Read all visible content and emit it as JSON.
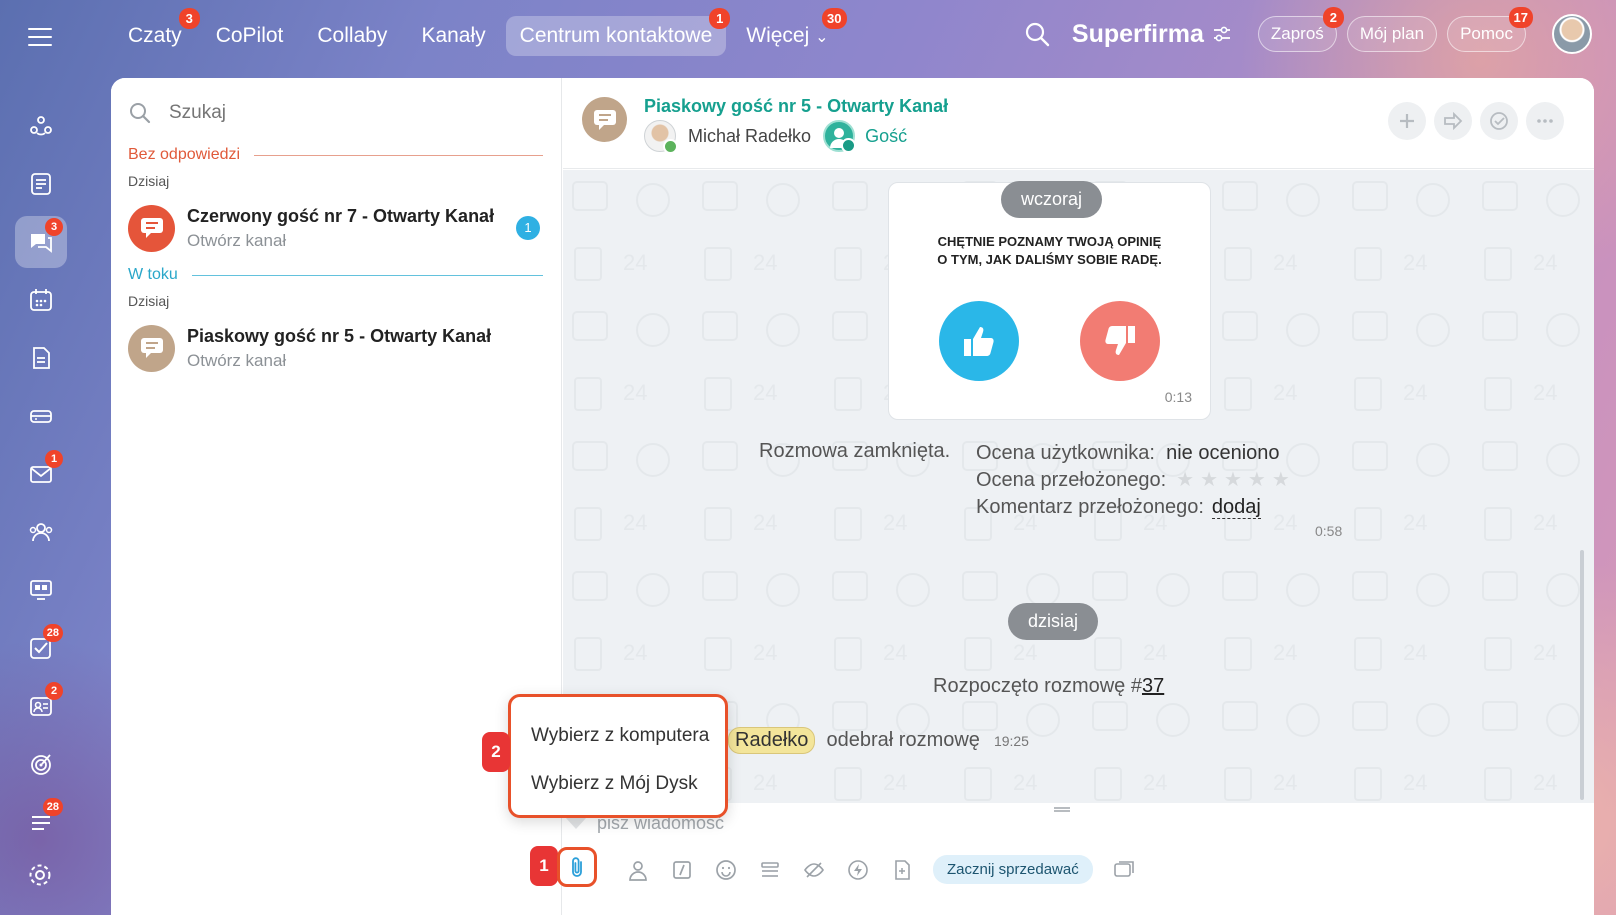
{
  "colors": {
    "accent_teal": "#16a08f",
    "badge_red": "#f0432a",
    "section_unanswered": "#e05a3a",
    "section_inprogress": "#2aa7c9",
    "highlight": "#e8512a"
  },
  "topbar": {
    "tabs": [
      {
        "label": "Czaty",
        "badge": "3"
      },
      {
        "label": "CoPilot",
        "badge": ""
      },
      {
        "label": "Collaby",
        "badge": ""
      },
      {
        "label": "Kanały",
        "badge": ""
      },
      {
        "label": "Centrum kontaktowe",
        "badge": "1",
        "active": true
      },
      {
        "label": "Więcej",
        "badge": "30"
      }
    ],
    "more_chevron": "⌄",
    "company": "Superfirma",
    "invite_label": "Zaproś",
    "invite_badge": "2",
    "plan_label": "Mój plan",
    "help_label": "Pomoc",
    "help_badge": "17"
  },
  "sidebar": {
    "badges": {
      "chats": "3",
      "mail": "1",
      "tasks": "28",
      "crm": "2",
      "feed": "28"
    }
  },
  "list": {
    "search_placeholder": "Szukaj",
    "section_unanswered": "Bez odpowiedzi",
    "section_inprogress": "W toku",
    "day1": "Dzisiaj",
    "day2": "Dzisiaj",
    "items": [
      {
        "title": "Czerwony gość nr 7 - Otwarty Kanał",
        "subtitle": "Otwórz kanał",
        "count": "1"
      },
      {
        "title": "Piaskowy gość nr 5 - Otwarty Kanał",
        "subtitle": "Otwórz kanał"
      }
    ]
  },
  "chat": {
    "title": "Piaskowy gość nr 5 - Otwarty Kanał",
    "member1": "Michał Radełko",
    "member2": "Gość",
    "date_yesterday": "wczoraj",
    "survey_line1": "CHĘTNIE POZNAMY TWOJĄ OPINIĘ",
    "survey_line2": "O TYM, JAK DALIŚMY SOBIE RADĘ.",
    "survey_time": "0:13",
    "closed": "Rozmowa zamknięta.",
    "user_rating_label": "Ocena użytkownika:",
    "user_rating_value": "nie oceniono",
    "supervisor_rating_label": "Ocena przełożonego:",
    "supervisor_comment_label": "Komentarz przełożonego:",
    "add_link": "dodaj",
    "closed_time": "0:58",
    "date_today": "dzisiaj",
    "started_prefix": "Rozpoczęto rozmowę #",
    "started_number": "37",
    "received_name": "Radełko",
    "received_text": "odebrał rozmowę",
    "received_time": "19:25",
    "input_placeholder": "pisz wiadomość",
    "sell_button": "Zacznij sprzedawać"
  },
  "popup": {
    "option1": "Wybierz z komputera",
    "option2": "Wybierz z Mój Dysk"
  },
  "steps": {
    "one": "1",
    "two": "2"
  }
}
